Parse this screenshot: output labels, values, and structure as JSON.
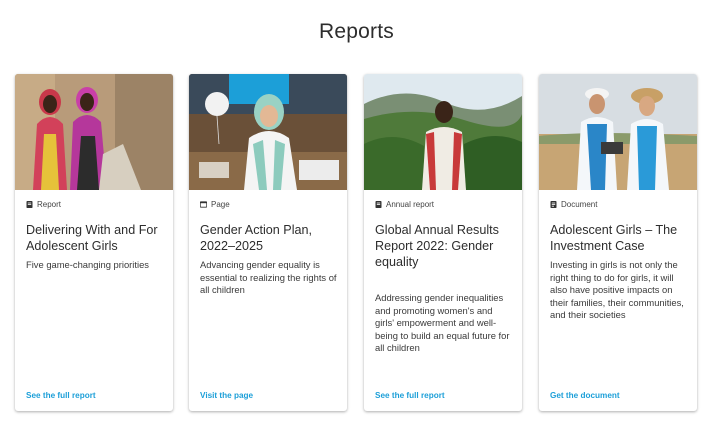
{
  "page": {
    "title": "Reports"
  },
  "cards": [
    {
      "type": "Report",
      "type_icon": "report-icon",
      "heading": "Delivering With and For Adolescent Girls",
      "description": "Five game-changing priorities",
      "link": "See the full report"
    },
    {
      "type": "Page",
      "type_icon": "page-icon",
      "heading": "Gender Action Plan, 2022–2025",
      "description": "Advancing gender equality is essential to realizing the rights of all children",
      "link": "Visit the page"
    },
    {
      "type": "Annual report",
      "type_icon": "report-icon",
      "heading": "Global Annual Results Report 2022: Gender equality",
      "description": "Addressing gender inequalities and promoting women's and girls' empowerment and well-being to build an equal future for all children",
      "link": "See the full report"
    },
    {
      "type": "Document",
      "type_icon": "document-icon",
      "heading": "Adolescent Girls – The Investment Case",
      "description": "Investing in girls is not only the right thing to do for girls, it will also have positive impacts on their families, their communities, and their societies",
      "link": "Get the document"
    }
  ],
  "colors": {
    "link": "#1c9fd8",
    "text": "#2d2d2d"
  }
}
